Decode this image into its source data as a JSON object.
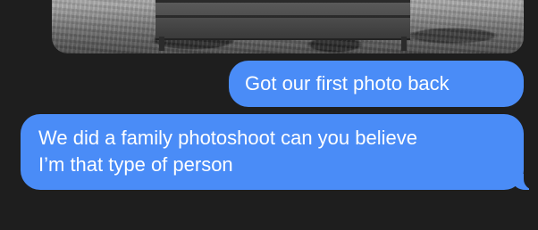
{
  "conversation": {
    "messages": [
      {
        "type": "photo",
        "direction": "outgoing"
      },
      {
        "type": "text",
        "direction": "outgoing",
        "text": "Got our first photo back"
      },
      {
        "type": "text",
        "direction": "outgoing",
        "text": "We did a family photoshoot can you believe\nI’m that type of person"
      }
    ]
  },
  "colors": {
    "background": "#1e1e1e",
    "outgoing_bubble": "#4a8cf7",
    "bubble_text": "#ffffff"
  }
}
